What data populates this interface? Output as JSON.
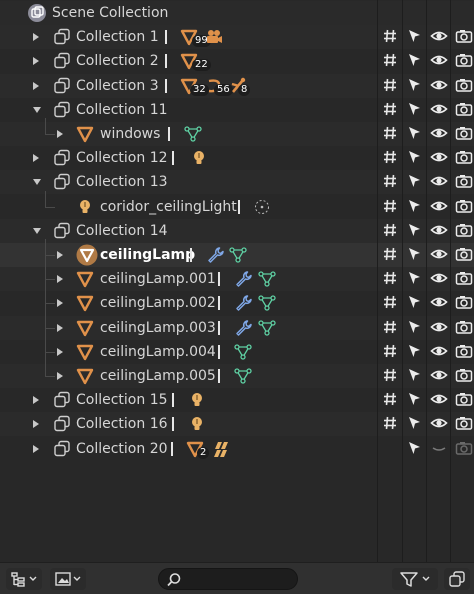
{
  "header": {
    "title": "Scene Collection"
  },
  "rows": [
    {
      "label": "Collection 1",
      "counts": [
        "99"
      ]
    },
    {
      "label": "Collection 2",
      "counts": [
        "22"
      ]
    },
    {
      "label": "Collection 3",
      "counts": [
        "32",
        "56",
        "8"
      ]
    },
    {
      "label": "Collection 11"
    },
    {
      "label": "windows"
    },
    {
      "label": "Collection 12"
    },
    {
      "label": "Collection 13"
    },
    {
      "label": "coridor_ceilingLight"
    },
    {
      "label": "Collection 14"
    },
    {
      "label": "ceilingLamp"
    },
    {
      "label": "ceilingLamp.001"
    },
    {
      "label": "ceilingLamp.002"
    },
    {
      "label": "ceilingLamp.003"
    },
    {
      "label": "ceilingLamp.004"
    },
    {
      "label": "ceilingLamp.005"
    },
    {
      "label": "Collection 15"
    },
    {
      "label": "Collection 16"
    },
    {
      "label": "Collection 20",
      "counts": [
        "2"
      ]
    }
  ],
  "colors": {
    "object_orange": "#e0914a",
    "mesh_green": "#5fd1a4",
    "modifier_blue": "#7fa7e6",
    "light_orange": "#e9b266"
  },
  "footer": {
    "display_mode_icon": "outliner-view-layer-icon",
    "filter_icon": "filter-funnel-icon",
    "new_collection_icon": "new-collection-icon",
    "search_placeholder": ""
  }
}
